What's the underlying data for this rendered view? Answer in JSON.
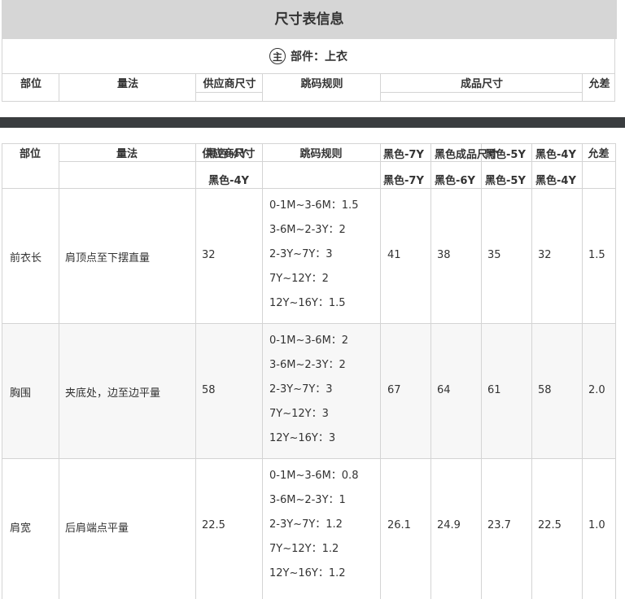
{
  "panel": {
    "title": "尺寸表信息"
  },
  "part": {
    "badge": "主",
    "label": "部件：上衣"
  },
  "headers": {
    "position": "部位",
    "method": "量法",
    "supplier_size": "供应商尺寸",
    "rules": "跳码规则",
    "finished_size": "成品尺寸",
    "tolerance": "允差"
  },
  "sizes": [
    "黑色-7Y",
    "黑色-6Y",
    "黑色-5Y",
    "黑色-4Y"
  ],
  "overlap": {
    "finished_partial": "黑色成品尺寸",
    "supplier_sub": "黑色-4Y"
  },
  "rows": [
    {
      "position": "前衣长",
      "method": "肩顶点至下摆直量",
      "supplier": "32",
      "rules": [
        "0-1M~3-6M：1.5",
        "3-6M~2-3Y：2",
        "2-3Y~7Y：3",
        "7Y~12Y：2",
        "12Y~16Y：1.5"
      ],
      "values": [
        "41",
        "38",
        "35",
        "32"
      ],
      "tolerance": "1.5"
    },
    {
      "position": "胸围",
      "method": "夹底处，边至边平量",
      "supplier": "58",
      "rules": [
        "0-1M~3-6M：2",
        "3-6M~2-3Y：2",
        "2-3Y~7Y：3",
        "7Y~12Y：3",
        "12Y~16Y：3"
      ],
      "values": [
        "67",
        "64",
        "61",
        "58"
      ],
      "tolerance": "2.0"
    },
    {
      "position": "肩宽",
      "method": "后肩端点平量",
      "supplier": "22.5",
      "rules": [
        "0-1M~3-6M：0.8",
        "3-6M~2-3Y：1",
        "2-3Y~7Y：1.2",
        "7Y~12Y：1.2",
        "12Y~16Y：1.2"
      ],
      "values": [
        "26.1",
        "24.9",
        "23.7",
        "22.5"
      ],
      "tolerance": "1.0"
    }
  ]
}
